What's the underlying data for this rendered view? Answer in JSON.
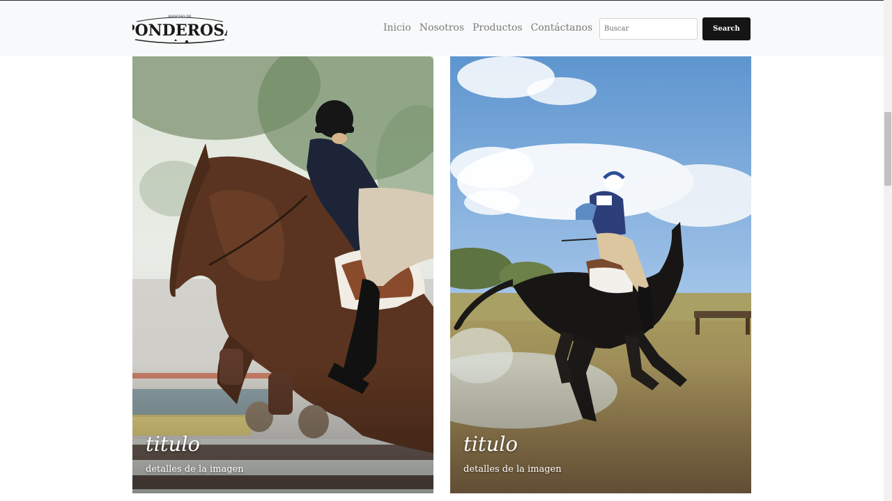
{
  "brand": {
    "tagline": "RANCHO DE",
    "name": "PONDEROSA"
  },
  "nav": {
    "items": [
      {
        "label": "Inicio"
      },
      {
        "label": "Nosotros"
      },
      {
        "label": "Productos"
      },
      {
        "label": "Contáctanos"
      }
    ]
  },
  "search": {
    "placeholder": "Buscar",
    "value": "",
    "button_label": "Search"
  },
  "gallery": {
    "cards": [
      {
        "title": "titulo",
        "details": "detalles de la imagen",
        "image_subject": "show jumping rider in navy jacket on bay horse"
      },
      {
        "title": "titulo",
        "details": "detalles de la imagen",
        "image_subject": "cross-country rider number 89 galloping through water"
      }
    ]
  },
  "colors": {
    "navbar_bg": "#f8f9fa",
    "nav_link": "#7a7a7a",
    "search_button_bg": "#151515"
  }
}
